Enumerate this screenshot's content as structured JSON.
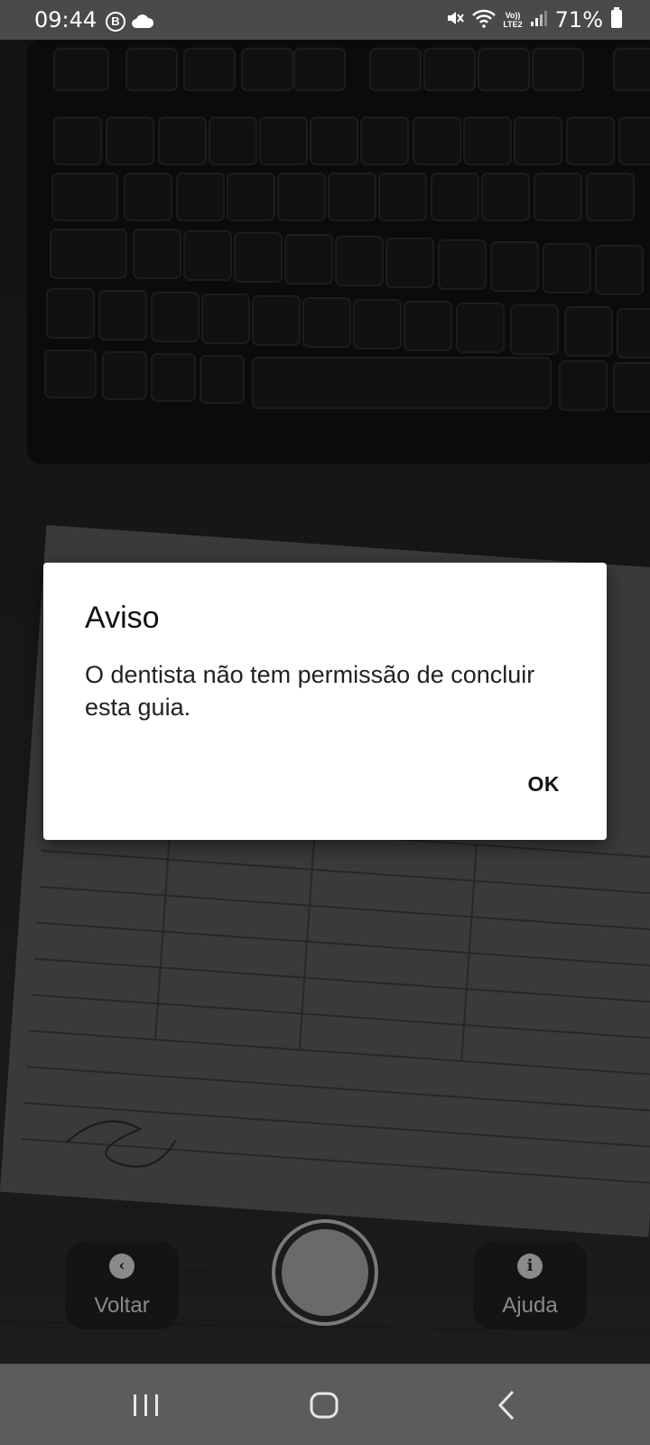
{
  "status_bar": {
    "time": "09:44",
    "badge_letter": "B",
    "battery_percent": "71%",
    "network_label_top": "Vo))",
    "network_label_bottom": "LTE2",
    "icons": [
      "b-badge-icon",
      "cloud-icon",
      "mute-icon",
      "wifi-icon",
      "signal-icon",
      "battery-icon"
    ]
  },
  "camera": {
    "back_label": "Voltar",
    "help_label": "Ajuda",
    "back_icon": "chevron-left-icon",
    "help_icon": "info-icon",
    "shutter_icon": "shutter-icon"
  },
  "dialog": {
    "title": "Aviso",
    "message": "O dentista não tem permissão de concluir esta guia.",
    "ok_label": "OK"
  },
  "nav_bar": {
    "icons": [
      "recents-icon",
      "home-icon",
      "back-icon"
    ]
  }
}
